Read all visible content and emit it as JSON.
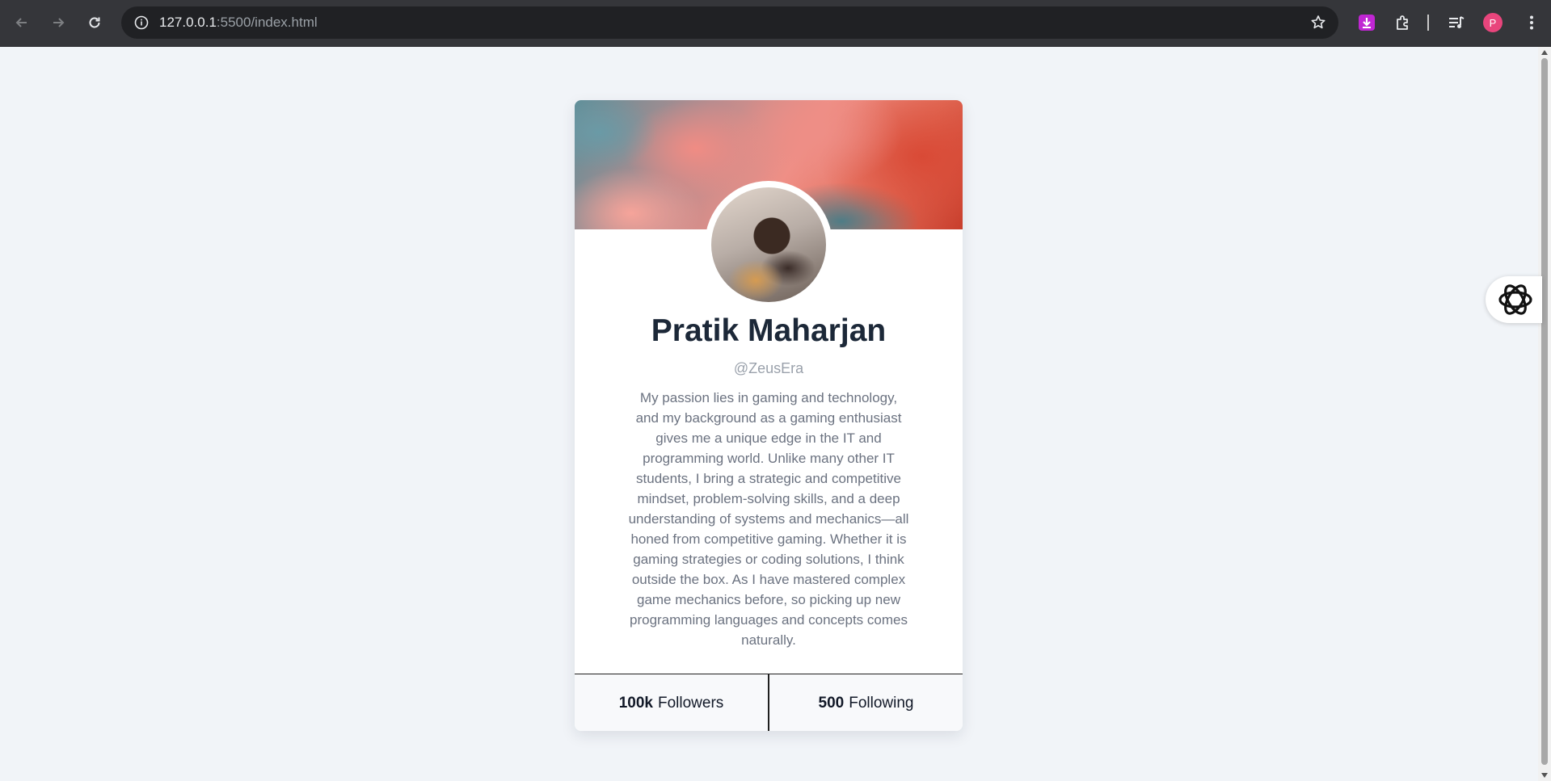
{
  "browser": {
    "url_host": "127.0.0.1",
    "url_path": ":5500/index.html",
    "profile_initial": "P"
  },
  "profile": {
    "name": "Pratik Maharjan",
    "handle": "@ZeusEra",
    "bio": "My passion lies in gaming and technology, and my background as a gaming enthusiast gives me a unique edge in the IT and programming world. Unlike many other IT students, I bring a strategic and competitive mindset, problem-solving skills, and a deep understanding of systems and mechanics—all honed from competitive gaming. Whether it is gaming strategies or coding solutions, I think outside the box. As I have mastered complex game mechanics before, so picking up new programming languages and concepts comes naturally."
  },
  "stats": {
    "followers_value": "100k",
    "followers_label": "Followers",
    "following_value": "500",
    "following_label": "Following"
  },
  "icons": {
    "back": "arrow-left-icon",
    "forward": "arrow-right-icon",
    "reload": "reload-icon",
    "info": "info-icon",
    "bookmark": "star-icon",
    "download_ext": "download-extension-icon",
    "extensions": "puzzle-icon",
    "media": "media-queue-icon",
    "menu": "kebab-menu-icon",
    "assistant": "openai-logo-icon"
  }
}
